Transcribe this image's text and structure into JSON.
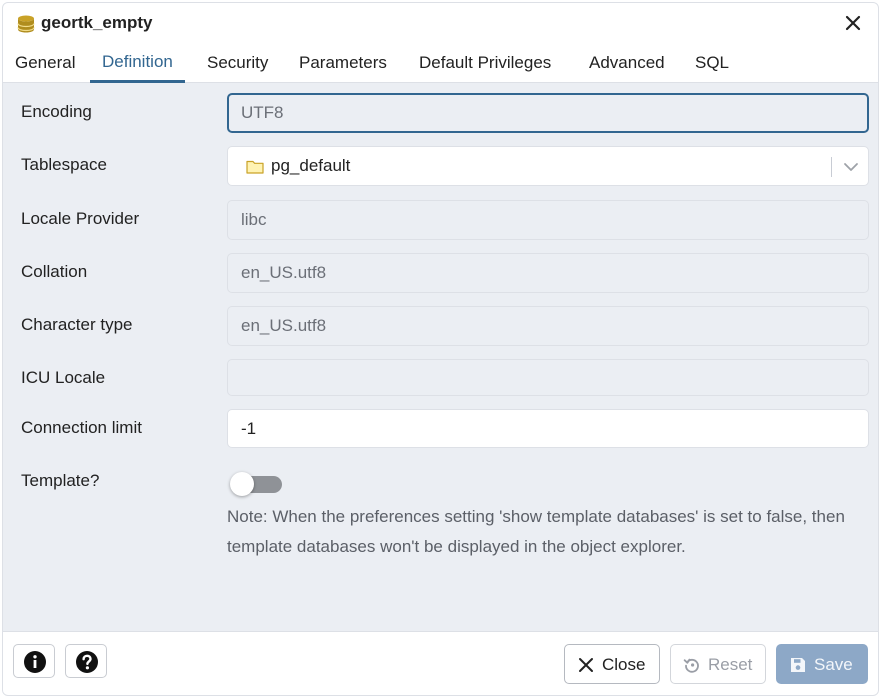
{
  "dialog": {
    "title": "geortk_empty",
    "title_icon": "database-icon",
    "close_icon": "close-icon"
  },
  "tabs": [
    {
      "label": "General",
      "active": false
    },
    {
      "label": "Definition",
      "active": true
    },
    {
      "label": "Security",
      "active": false
    },
    {
      "label": "Parameters",
      "active": false
    },
    {
      "label": "Default Privileges",
      "active": false
    },
    {
      "label": "Advanced",
      "active": false
    },
    {
      "label": "SQL",
      "active": false
    }
  ],
  "form": {
    "encoding": {
      "label": "Encoding",
      "value": "UTF8"
    },
    "tablespace": {
      "label": "Tablespace",
      "value": "pg_default",
      "icon": "folder-icon"
    },
    "locale_provider": {
      "label": "Locale Provider",
      "value": "libc"
    },
    "collation": {
      "label": "Collation",
      "value": "en_US.utf8"
    },
    "character_type": {
      "label": "Character type",
      "value": "en_US.utf8"
    },
    "icu_locale": {
      "label": "ICU Locale",
      "value": ""
    },
    "connection_limit": {
      "label": "Connection limit",
      "value": "-1"
    },
    "template": {
      "label": "Template?",
      "checked": false
    },
    "note": "Note: When the preferences setting 'show template databases' is set to false, then template databases won't be displayed in the object explorer."
  },
  "footer": {
    "info_icon": "info-icon",
    "help_icon": "help-icon",
    "close_label": "Close",
    "reset_label": "Reset",
    "save_label": "Save"
  },
  "colors": {
    "accent": "#326690",
    "panel_bg": "#ebeef3",
    "save_button": "#8da8c7",
    "folder": "#f5d76e"
  }
}
